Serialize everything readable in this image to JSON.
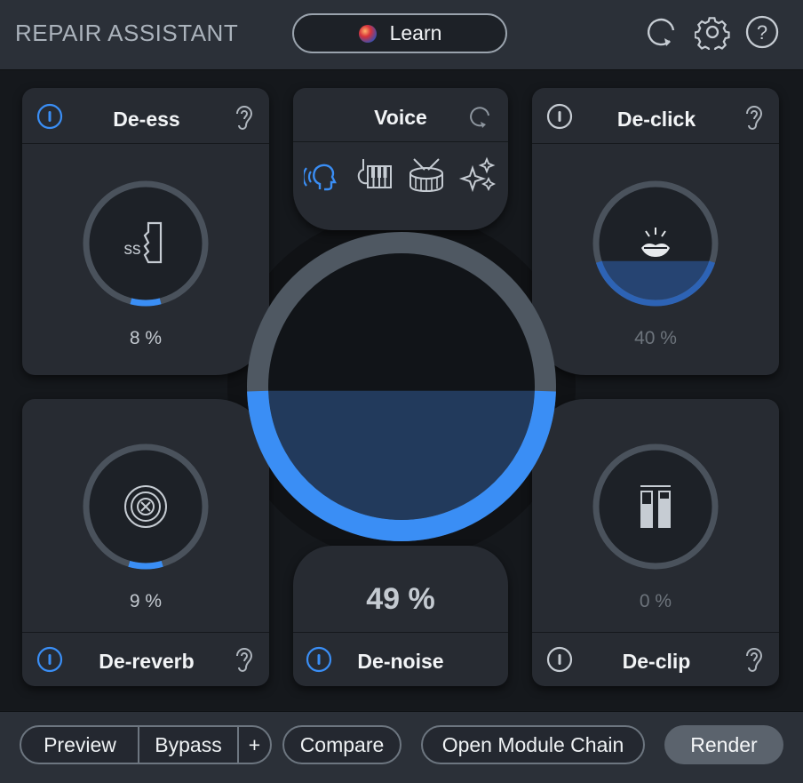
{
  "header": {
    "title": "REPAIR ASSISTANT",
    "learn_label": "Learn"
  },
  "voice_panel": {
    "title": "Voice",
    "types": [
      "voice-icon",
      "instruments-icon",
      "drum-icon",
      "sparkle-icon"
    ]
  },
  "modules": {
    "de_ess": {
      "title": "De-ess",
      "value_text": "8 %",
      "amount": 0.08,
      "enabled": true
    },
    "de_click": {
      "title": "De-click",
      "value_text": "40 %",
      "amount": 0.4,
      "enabled": false
    },
    "de_reverb": {
      "title": "De-reverb",
      "value_text": "9 %",
      "amount": 0.09,
      "enabled": true
    },
    "de_clip": {
      "title": "De-clip",
      "value_text": "0 %",
      "amount": 0.0,
      "enabled": false
    },
    "de_noise": {
      "title": "De-noise",
      "value_text": "49 %",
      "amount": 0.49,
      "enabled": true
    }
  },
  "footer": {
    "preview_label": "Preview",
    "bypass_label": "Bypass",
    "plus_label": "+",
    "compare_label": "Compare",
    "chain_label": "Open Module Chain",
    "render_label": "Render"
  },
  "colors": {
    "accent": "#3a8ef5",
    "ring": "#4a525c",
    "panel": "#272b32"
  }
}
